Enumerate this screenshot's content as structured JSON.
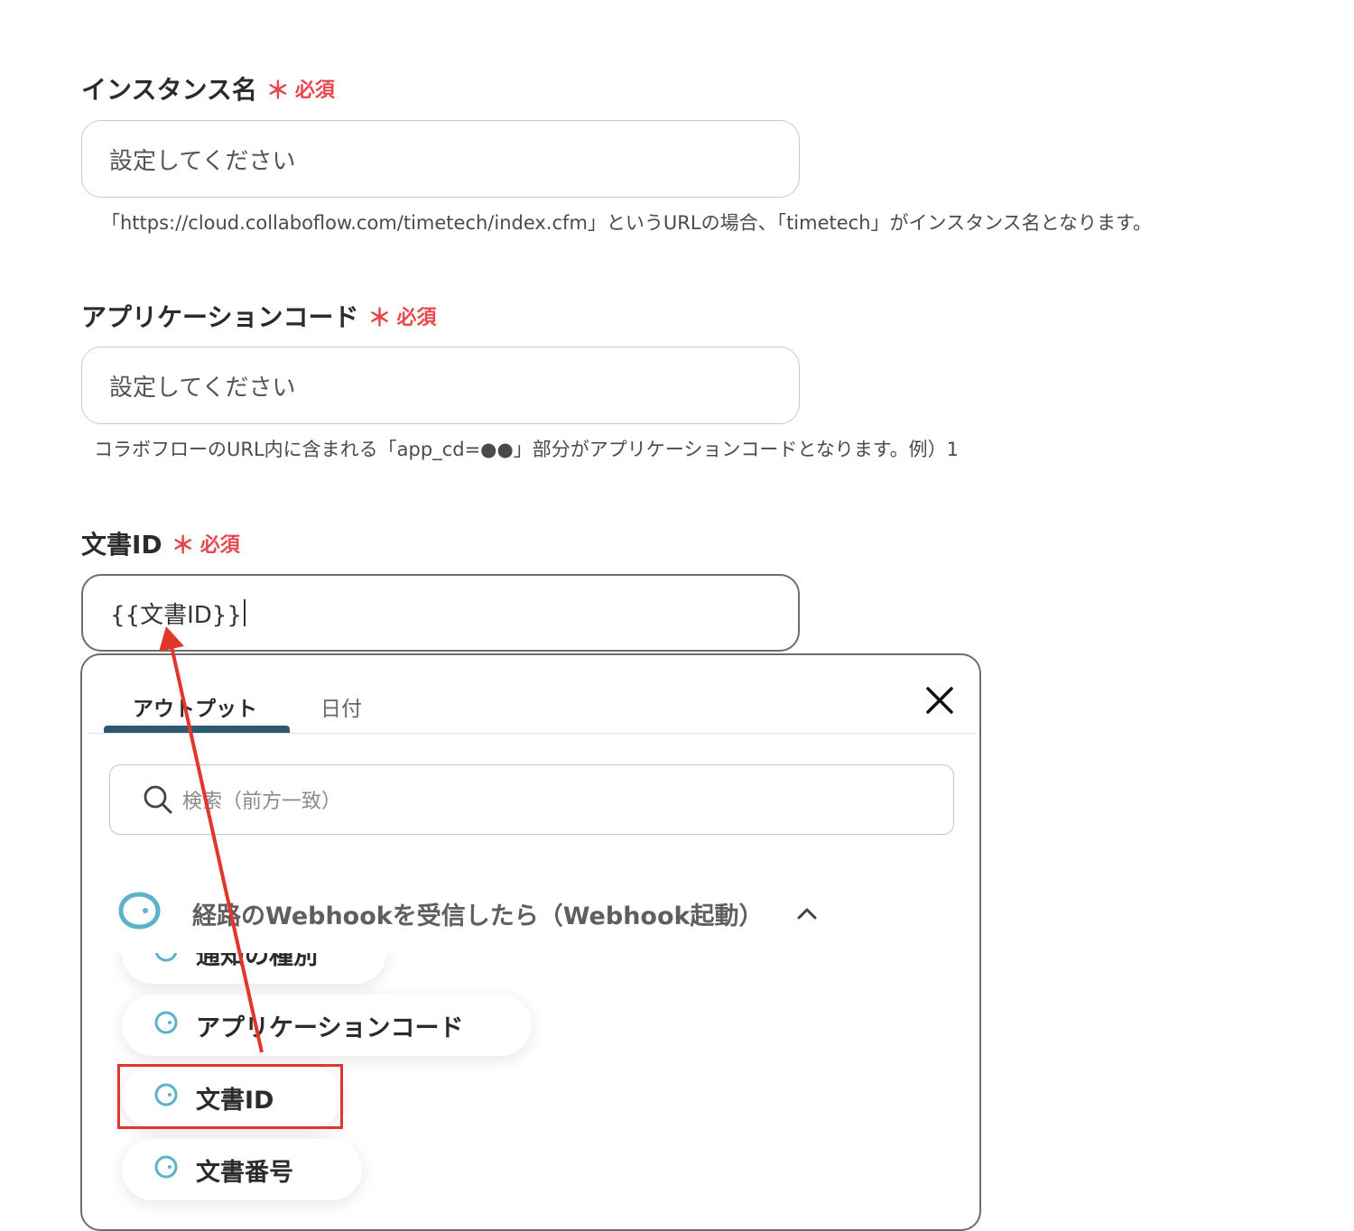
{
  "fields": [
    {
      "label": "インスタンス名",
      "required_mark": "＊",
      "required_text": "必須",
      "placeholder": "設定してください",
      "value": "",
      "help": "「https://cloud.collaboflow.com/timetech/index.cfm」というURLの場合、「timetech」がインスタンス名となります。"
    },
    {
      "label": "アプリケーションコード",
      "required_mark": "＊",
      "required_text": "必須",
      "placeholder": "設定してください",
      "value": "",
      "help": "コラボフローのURL内に含まれる「app_cd=●●」部分がアプリケーションコードとなります。例）1"
    },
    {
      "label": "文書ID",
      "required_mark": "＊",
      "required_text": "必須",
      "value": "{{文書ID}}"
    }
  ],
  "panel": {
    "tabs": [
      {
        "label": "アウトプット",
        "active": true
      },
      {
        "label": "日付",
        "active": false
      }
    ],
    "close_icon": "close-icon",
    "search_placeholder": "検索（前方一致）",
    "group": {
      "title": "経路のWebhookを受信したら（Webhook起動）",
      "expanded": true
    },
    "items": [
      {
        "label": "通知の種別"
      },
      {
        "label": "アプリケーションコード"
      },
      {
        "label": "文書ID",
        "highlighted": true
      },
      {
        "label": "文書番号"
      }
    ]
  },
  "colors": {
    "required": "#e5484d",
    "tab_accent": "#2d5a72",
    "annotation": "#e0362b",
    "icon": "#5ab3c9"
  }
}
